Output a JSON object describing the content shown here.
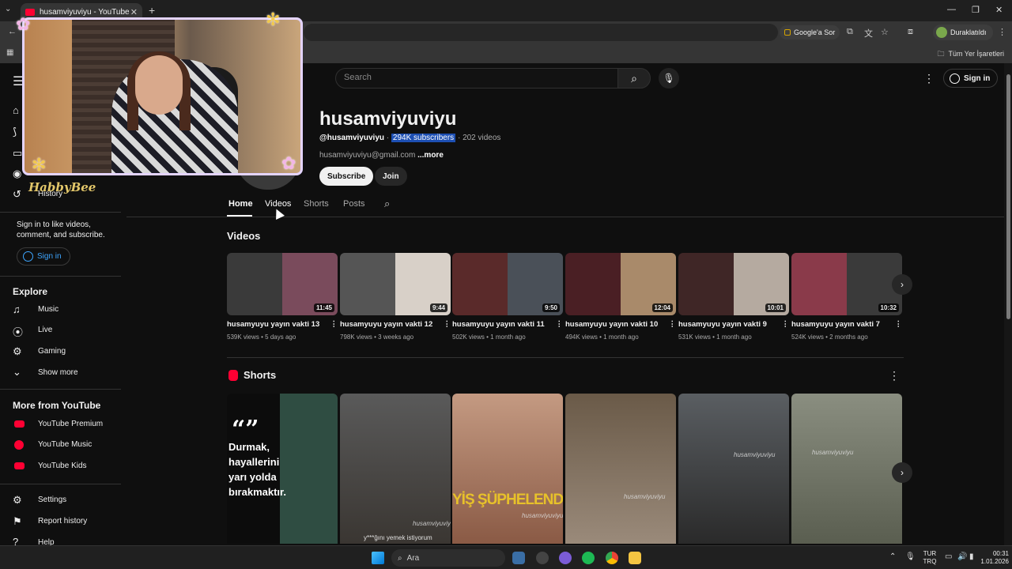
{
  "browser": {
    "tab_title": "husamviyuviyu - YouTube",
    "ask_google": "Google'a Sor",
    "profile_status": "Duraklatıldı",
    "all_bookmarks": "Tüm Yer İşaretleri"
  },
  "youtube": {
    "search_placeholder": "Search",
    "sign_in": "Sign in"
  },
  "sidebar": {
    "history": "History",
    "sign_in_prompt": "Sign in to like videos, comment, and subscribe.",
    "sign_in": "Sign in",
    "explore_heading": "Explore",
    "explore": [
      "Music",
      "Live",
      "Gaming",
      "Show more"
    ],
    "more_heading": "More from YouTube",
    "more": [
      "YouTube Premium",
      "YouTube Music",
      "YouTube Kids"
    ],
    "bottom": [
      "Settings",
      "Report history",
      "Help"
    ]
  },
  "overlay": {
    "brand": "HabbyBee"
  },
  "channel": {
    "name": "husamviyuviyu",
    "handle": "@husamviyuviyu",
    "subscribers": "294K subscribers",
    "videos_count": "202 videos",
    "email": "husamviyuviyu@gmail.com",
    "more": "...more",
    "subscribe": "Subscribe",
    "join": "Join",
    "tabs": [
      "Home",
      "Videos",
      "Shorts",
      "Posts"
    ]
  },
  "videos_section": {
    "title": "Videos",
    "items": [
      {
        "title": "husamyuyu yayın vakti 13",
        "views": "539K views",
        "age": "5 days ago",
        "duration": "11:45"
      },
      {
        "title": "husamyuyu yayın vakti 12",
        "views": "798K views",
        "age": "3 weeks ago",
        "duration": "9:44"
      },
      {
        "title": "husamyuyu yayın vakti 11",
        "views": "502K views",
        "age": "1 month ago",
        "duration": "9:50"
      },
      {
        "title": "husamyuyu yayın vakti 10",
        "views": "494K views",
        "age": "1 month ago",
        "duration": "12:04"
      },
      {
        "title": "husamyuyu yayın vakti 9",
        "views": "531K views",
        "age": "1 month ago",
        "duration": "10:01"
      },
      {
        "title": "husamyuyu yayın vakti 7",
        "views": "524K views",
        "age": "2 months ago",
        "duration": "10:32"
      }
    ]
  },
  "shorts_section": {
    "title": "Shorts",
    "short1_text": "Durmak, hayallerini yarı yolda bırakmaktır.",
    "short2_caption": "y***ğını yemek istiyorum",
    "short3_text": "YİŞ ŞÜPHELENDİ",
    "watermark": "husamviyuviyu"
  },
  "taskbar": {
    "search": "Ara",
    "lang_top": "TUR",
    "lang_bottom": "TRQ",
    "time": "00:31",
    "date": "1.01.2026"
  }
}
